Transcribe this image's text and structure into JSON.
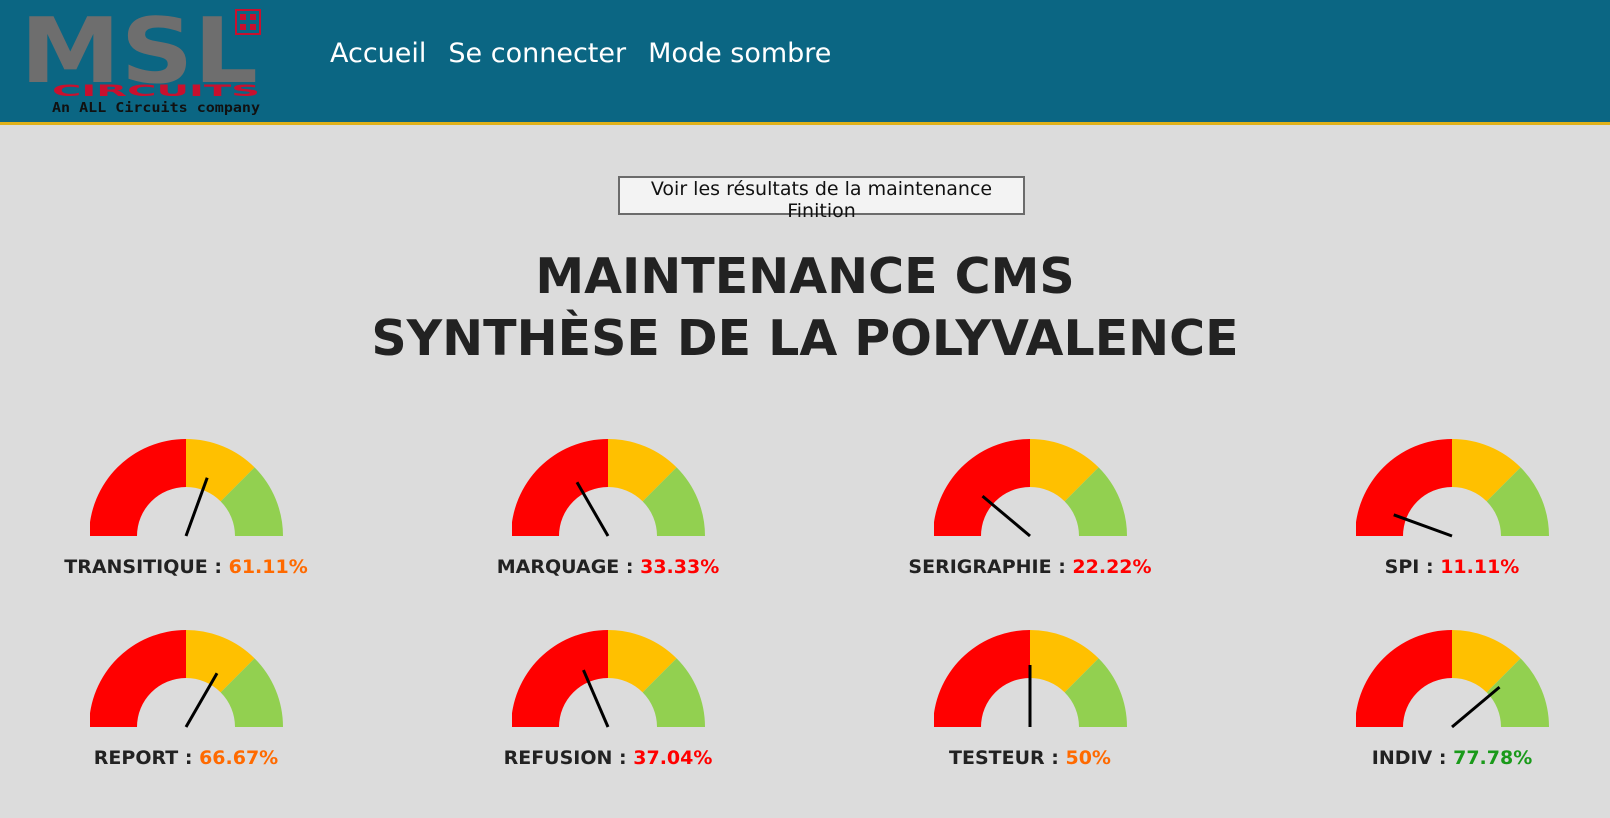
{
  "header": {
    "logo": {
      "main": "MSL",
      "sub": "CIRCUITS",
      "tagline": "An ALL Circuits company"
    },
    "nav": [
      {
        "label": "Accueil"
      },
      {
        "label": "Se connecter"
      },
      {
        "label": "Mode sombre"
      }
    ]
  },
  "action_button": {
    "label": "Voir les résultats de la maintenance Finition"
  },
  "title": {
    "line1": "MAINTENANCE CMS",
    "line2": "SYNTHÈSE DE LA POLYVALENCE"
  },
  "colors": {
    "zone_red": "#ff0000",
    "zone_yellow": "#ffc000",
    "zone_green": "#92d050",
    "pct_red": "#ff0000",
    "pct_orange": "#ff6a00",
    "pct_green": "#1a9a1a"
  },
  "gauges": [
    {
      "name": "TRANSITIQUE",
      "value": 61.11,
      "display": "61.11%",
      "status": "orange"
    },
    {
      "name": "MARQUAGE",
      "value": 33.33,
      "display": "33.33%",
      "status": "red"
    },
    {
      "name": "SERIGRAPHIE",
      "value": 22.22,
      "display": "22.22%",
      "status": "red"
    },
    {
      "name": "SPI",
      "value": 11.11,
      "display": "11.11%",
      "status": "red"
    },
    {
      "name": "REPORT",
      "value": 66.67,
      "display": "66.67%",
      "status": "orange"
    },
    {
      "name": "REFUSION",
      "value": 37.04,
      "display": "37.04%",
      "status": "red"
    },
    {
      "name": "TESTEUR",
      "value": 50,
      "display": "50%",
      "status": "orange"
    },
    {
      "name": "INDIV",
      "value": 77.78,
      "display": "77.78%",
      "status": "green"
    }
  ]
}
